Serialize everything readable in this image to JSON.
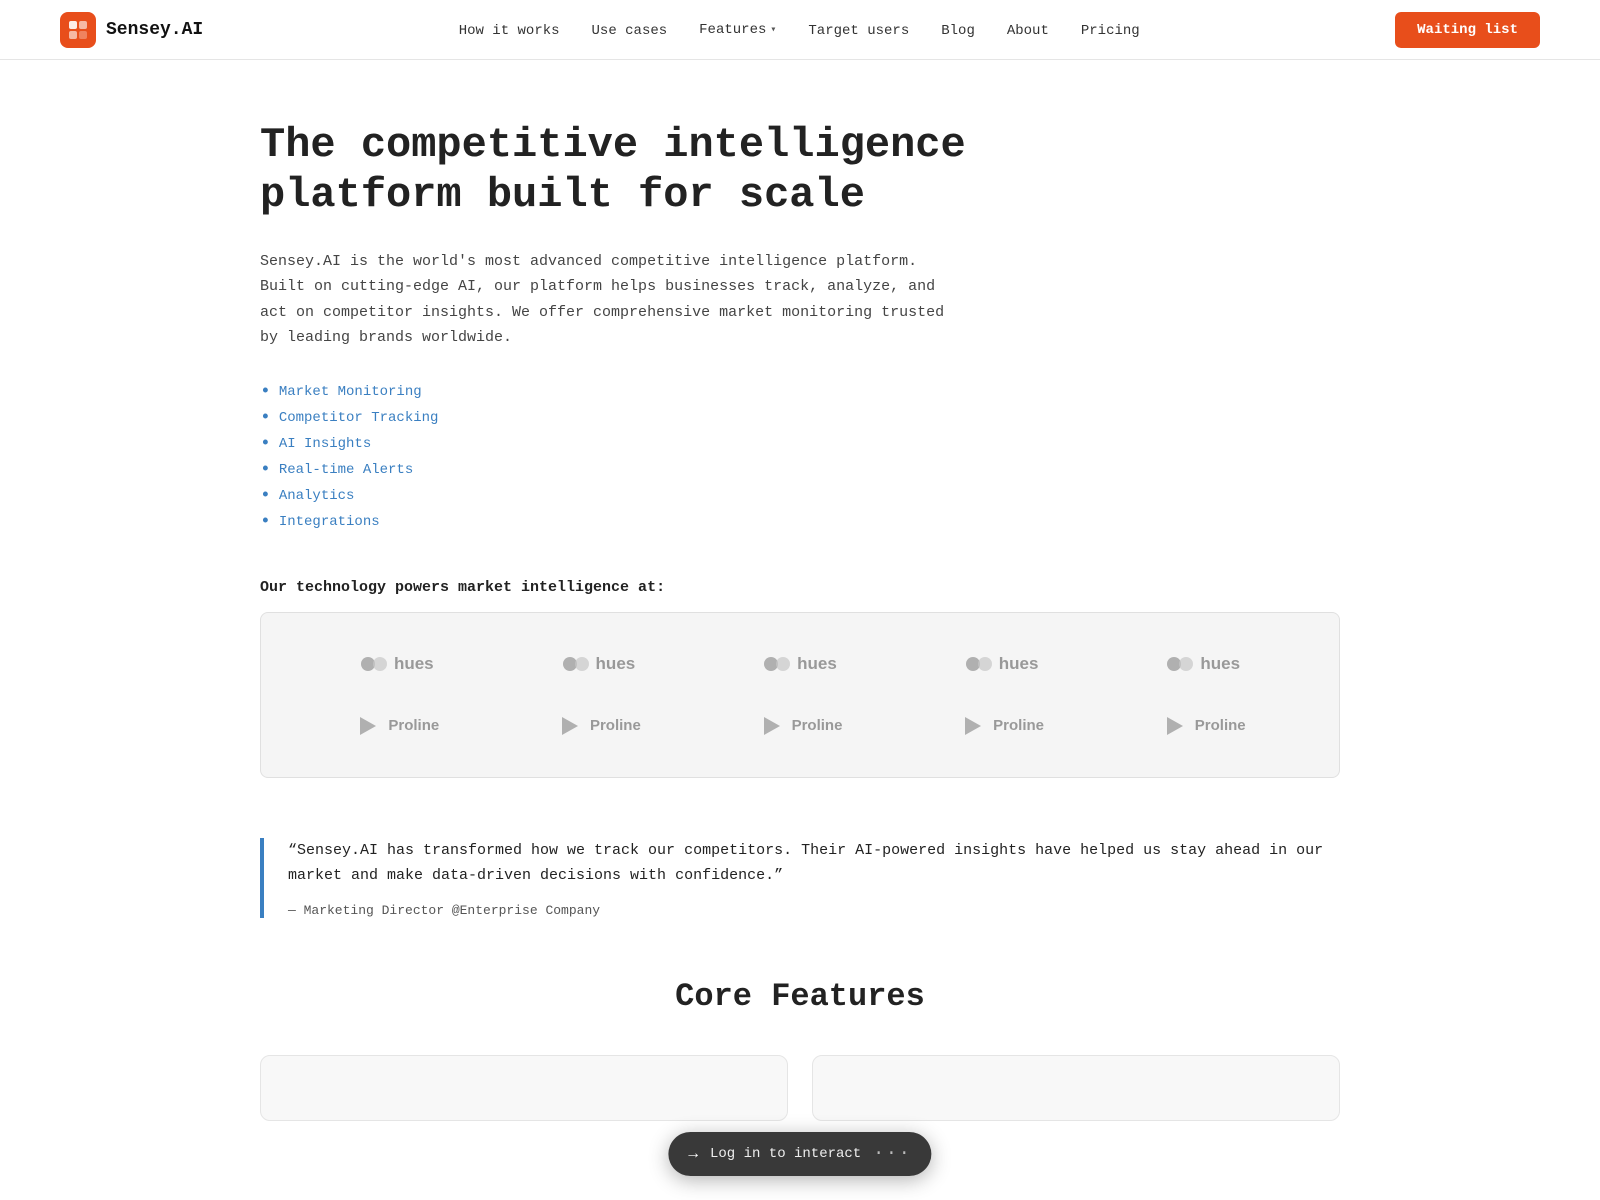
{
  "navbar": {
    "logo_text": "Sensey.AI",
    "nav_items": [
      {
        "label": "How it works",
        "href": "#"
      },
      {
        "label": "Use cases",
        "href": "#"
      },
      {
        "label": "Features",
        "href": "#",
        "has_dropdown": true
      },
      {
        "label": "Target users",
        "href": "#"
      },
      {
        "label": "Blog",
        "href": "#"
      },
      {
        "label": "About",
        "href": "#"
      },
      {
        "label": "Pricing",
        "href": "#"
      }
    ],
    "cta_label": "Waiting list"
  },
  "hero": {
    "title": "The competitive intelligence platform built for scale",
    "description": "Sensey.AI is the world's most advanced competitive intelligence platform. Built on cutting-edge AI, our platform helps businesses track, analyze, and act on competitor insights. We offer comprehensive market monitoring trusted by leading brands worldwide.",
    "features": [
      "Market Monitoring",
      "Competitor Tracking",
      "AI Insights",
      "Real-time Alerts",
      "Analytics",
      "Integrations"
    ]
  },
  "logos_section": {
    "heading": "Our technology powers market intelligence at:",
    "row1": [
      "hues",
      "hues",
      "hues",
      "hues",
      "hues"
    ],
    "row2": [
      "Proline",
      "Proline",
      "Proline",
      "Proline",
      "Proline"
    ]
  },
  "testimonial": {
    "text": "“Sensey.AI has transformed how we track our competitors. Their AI-powered insights have helped us stay ahead in our market and make data-driven decisions with confidence.”",
    "author": "— Marketing Director @Enterprise Company"
  },
  "core_features": {
    "title": "Core Features"
  },
  "login_bar": {
    "icon": "→",
    "label": "Log in to interact",
    "dots": "…"
  }
}
